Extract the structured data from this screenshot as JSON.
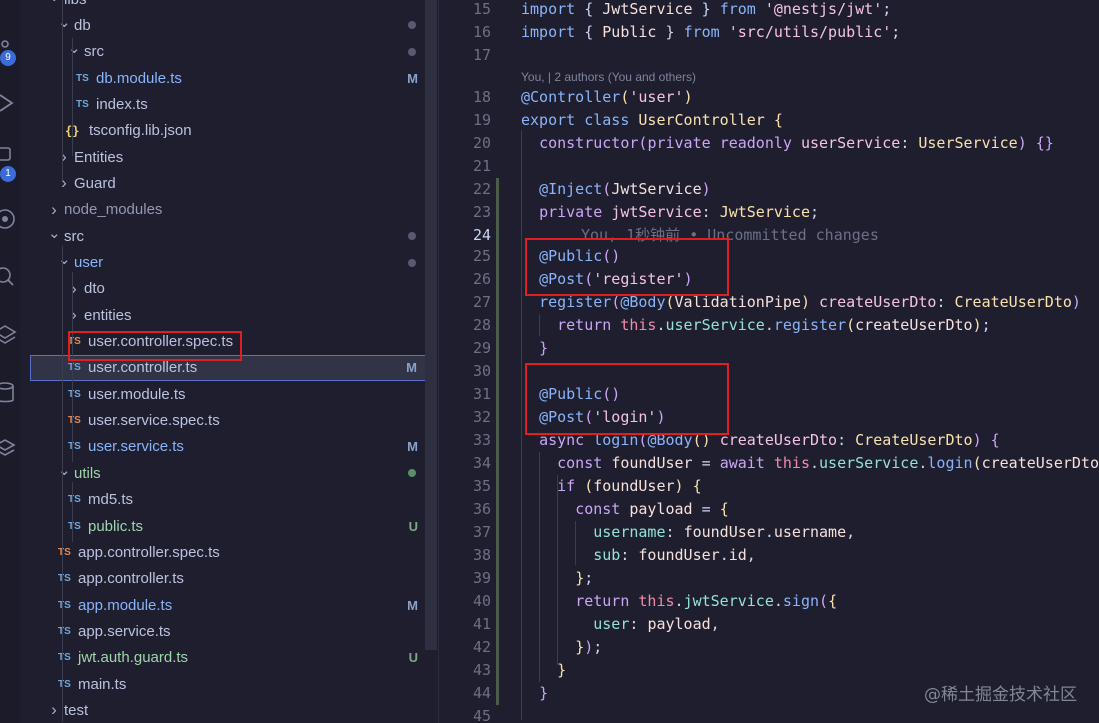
{
  "activity_bar": {
    "badges": {
      "source_control": "9",
      "extensions": "1"
    },
    "icons": [
      "source-control-icon",
      "run-debug-icon",
      "extensions-icon",
      "remote-icon",
      "search-icon",
      "layers-icon",
      "database-icon",
      "stack-icon"
    ]
  },
  "explorer": {
    "rows": [
      {
        "label": "libs",
        "kind": "folder",
        "open": true,
        "color": "folder"
      },
      {
        "label": "db",
        "kind": "folder",
        "open": true,
        "color": "folder",
        "dot": true
      },
      {
        "label": "src",
        "kind": "folder",
        "open": true,
        "color": "folder",
        "dot": true
      },
      {
        "label": "db.module.ts",
        "kind": "ts",
        "color": "modified",
        "status": "M"
      },
      {
        "label": "index.ts",
        "kind": "ts",
        "color": "default"
      },
      {
        "label": "tsconfig.lib.json",
        "kind": "json",
        "color": "default"
      },
      {
        "label": "Entities",
        "kind": "folder",
        "open": false,
        "color": "folder"
      },
      {
        "label": "Guard",
        "kind": "folder",
        "open": false,
        "color": "folder"
      },
      {
        "label": "node_modules",
        "kind": "folder",
        "open": false,
        "color": "dim"
      },
      {
        "label": "src",
        "kind": "folder",
        "open": true,
        "color": "folder",
        "dot": true
      },
      {
        "label": "user",
        "kind": "folder",
        "open": true,
        "color": "modified",
        "dot": true
      },
      {
        "label": "dto",
        "kind": "folder",
        "open": false,
        "color": "folder"
      },
      {
        "label": "entities",
        "kind": "folder",
        "open": false,
        "color": "folder"
      },
      {
        "label": "user.controller.spec.ts",
        "kind": "spec",
        "color": "default"
      },
      {
        "label": "user.controller.ts",
        "kind": "ts",
        "color": "default",
        "status": "M",
        "selected": true
      },
      {
        "label": "user.module.ts",
        "kind": "ts",
        "color": "default"
      },
      {
        "label": "user.service.spec.ts",
        "kind": "spec",
        "color": "default"
      },
      {
        "label": "user.service.ts",
        "kind": "ts",
        "color": "modified",
        "status": "M"
      },
      {
        "label": "utils",
        "kind": "folder",
        "open": true,
        "color": "untracked",
        "dot": "green"
      },
      {
        "label": "md5.ts",
        "kind": "ts",
        "color": "default"
      },
      {
        "label": "public.ts",
        "kind": "ts",
        "color": "untracked",
        "status": "U"
      },
      {
        "label": "app.controller.spec.ts",
        "kind": "spec",
        "color": "default"
      },
      {
        "label": "app.controller.ts",
        "kind": "ts",
        "color": "default"
      },
      {
        "label": "app.module.ts",
        "kind": "ts",
        "color": "modified",
        "status": "M"
      },
      {
        "label": "app.service.ts",
        "kind": "ts",
        "color": "default"
      },
      {
        "label": "jwt.auth.guard.ts",
        "kind": "ts",
        "color": "untracked",
        "status": "U"
      },
      {
        "label": "main.ts",
        "kind": "ts",
        "color": "default"
      },
      {
        "label": "test",
        "kind": "folder",
        "open": false,
        "color": "folder"
      }
    ]
  },
  "editor": {
    "blame_header": "You, | 2 authors (You and others)",
    "inline_blame": "You, 1秒钟前 • Uncommitted changes",
    "lines": [
      {
        "n": "15",
        "tokens": [
          [
            "kw",
            "import"
          ],
          [
            "punc",
            " { "
          ],
          [
            "var",
            "JwtService"
          ],
          [
            "punc",
            " } "
          ],
          [
            "kw",
            "from"
          ],
          [
            "punc",
            " "
          ],
          [
            "str",
            "'@nestjs/jwt'"
          ],
          [
            "punc",
            ";"
          ]
        ]
      },
      {
        "n": "16",
        "tokens": [
          [
            "kw",
            "import"
          ],
          [
            "punc",
            " { "
          ],
          [
            "var",
            "Public"
          ],
          [
            "punc",
            " } "
          ],
          [
            "kw",
            "from"
          ],
          [
            "punc",
            " "
          ],
          [
            "str",
            "'src/utils/public'"
          ],
          [
            "punc",
            ";"
          ]
        ]
      },
      {
        "n": "17",
        "tokens": []
      },
      {
        "n": "18",
        "tokens": [
          [
            "dec",
            "@Controller"
          ],
          [
            "brace",
            "("
          ],
          [
            "str",
            "'user'"
          ],
          [
            "brace",
            ")"
          ]
        ]
      },
      {
        "n": "19",
        "tokens": [
          [
            "kw",
            "export"
          ],
          [
            "punc",
            " "
          ],
          [
            "kw",
            "class"
          ],
          [
            "punc",
            " "
          ],
          [
            "cls",
            "UserController"
          ],
          [
            "punc",
            " "
          ],
          [
            "brace",
            "{"
          ]
        ]
      },
      {
        "n": "20",
        "tokens": [
          [
            "punc",
            "  "
          ],
          [
            "kw2",
            "constructor"
          ],
          [
            "brace2",
            "("
          ],
          [
            "kw2",
            "private"
          ],
          [
            "punc",
            " "
          ],
          [
            "kw2",
            "readonly"
          ],
          [
            "punc",
            " "
          ],
          [
            "param",
            "userService"
          ],
          [
            "punc",
            ": "
          ],
          [
            "cls",
            "UserService"
          ],
          [
            "brace2",
            ")"
          ],
          [
            "punc",
            " "
          ],
          [
            "brace2",
            "{}"
          ]
        ]
      },
      {
        "n": "21",
        "tokens": []
      },
      {
        "n": "22",
        "tokens": [
          [
            "punc",
            "  "
          ],
          [
            "dec",
            "@Inject"
          ],
          [
            "brace2",
            "("
          ],
          [
            "var",
            "JwtService"
          ],
          [
            "brace2",
            ")"
          ]
        ]
      },
      {
        "n": "23",
        "tokens": [
          [
            "punc",
            "  "
          ],
          [
            "kw2",
            "private"
          ],
          [
            "punc",
            " "
          ],
          [
            "param",
            "jwtService"
          ],
          [
            "punc",
            ": "
          ],
          [
            "cls",
            "JwtService"
          ],
          [
            "punc",
            ";"
          ]
        ]
      },
      {
        "n": "24",
        "tokens": [],
        "active": true
      },
      {
        "n": "25",
        "tokens": [
          [
            "punc",
            "  "
          ],
          [
            "dec",
            "@Public"
          ],
          [
            "brace2",
            "()"
          ]
        ]
      },
      {
        "n": "26",
        "tokens": [
          [
            "punc",
            "  "
          ],
          [
            "dec",
            "@Post"
          ],
          [
            "brace2",
            "("
          ],
          [
            "str",
            "'register'"
          ],
          [
            "brace2",
            ")"
          ]
        ]
      },
      {
        "n": "27",
        "tokens": [
          [
            "punc",
            "  "
          ],
          [
            "fn",
            "register"
          ],
          [
            "brace2",
            "("
          ],
          [
            "dec",
            "@Body"
          ],
          [
            "brace",
            "("
          ],
          [
            "var",
            "ValidationPipe"
          ],
          [
            "brace",
            ")"
          ],
          [
            "punc",
            " "
          ],
          [
            "param",
            "createUserDto"
          ],
          [
            "punc",
            ": "
          ],
          [
            "cls",
            "CreateUserDto"
          ],
          [
            "brace2",
            ")"
          ]
        ]
      },
      {
        "n": "28",
        "tokens": [
          [
            "punc",
            "    "
          ],
          [
            "kw2",
            "return"
          ],
          [
            "punc",
            " "
          ],
          [
            "this",
            "this"
          ],
          [
            "punc",
            "."
          ],
          [
            "prop",
            "userService"
          ],
          [
            "punc",
            "."
          ],
          [
            "fn",
            "register"
          ],
          [
            "brace",
            "("
          ],
          [
            "var",
            "createUserDto"
          ],
          [
            "brace",
            ")"
          ],
          [
            "punc",
            ";"
          ]
        ]
      },
      {
        "n": "29",
        "tokens": [
          [
            "punc",
            "  "
          ],
          [
            "brace2",
            "}"
          ]
        ]
      },
      {
        "n": "30",
        "tokens": []
      },
      {
        "n": "31",
        "tokens": [
          [
            "punc",
            "  "
          ],
          [
            "dec",
            "@Public"
          ],
          [
            "brace2",
            "()"
          ]
        ]
      },
      {
        "n": "32",
        "tokens": [
          [
            "punc",
            "  "
          ],
          [
            "dec",
            "@Post"
          ],
          [
            "brace2",
            "("
          ],
          [
            "str",
            "'login'"
          ],
          [
            "brace2",
            ")"
          ]
        ]
      },
      {
        "n": "33",
        "tokens": [
          [
            "punc",
            "  "
          ],
          [
            "kw2",
            "async"
          ],
          [
            "punc",
            " "
          ],
          [
            "fn",
            "login"
          ],
          [
            "brace2",
            "("
          ],
          [
            "dec",
            "@Body"
          ],
          [
            "brace",
            "()"
          ],
          [
            "punc",
            " "
          ],
          [
            "param",
            "createUserDto"
          ],
          [
            "punc",
            ": "
          ],
          [
            "cls",
            "CreateUserDto"
          ],
          [
            "brace2",
            ")"
          ],
          [
            "punc",
            " "
          ],
          [
            "brace2",
            "{"
          ]
        ]
      },
      {
        "n": "34",
        "tokens": [
          [
            "punc",
            "    "
          ],
          [
            "kw2",
            "const"
          ],
          [
            "punc",
            " "
          ],
          [
            "var",
            "foundUser"
          ],
          [
            "punc",
            " = "
          ],
          [
            "kw2",
            "await"
          ],
          [
            "punc",
            " "
          ],
          [
            "this",
            "this"
          ],
          [
            "punc",
            "."
          ],
          [
            "prop",
            "userService"
          ],
          [
            "punc",
            "."
          ],
          [
            "fn",
            "login"
          ],
          [
            "brace",
            "("
          ],
          [
            "var",
            "createUserDto"
          ]
        ]
      },
      {
        "n": "35",
        "tokens": [
          [
            "punc",
            "    "
          ],
          [
            "kw2",
            "if"
          ],
          [
            "punc",
            " "
          ],
          [
            "brace",
            "("
          ],
          [
            "var",
            "foundUser"
          ],
          [
            "brace",
            ")"
          ],
          [
            "punc",
            " "
          ],
          [
            "brace",
            "{"
          ]
        ]
      },
      {
        "n": "36",
        "tokens": [
          [
            "punc",
            "      "
          ],
          [
            "kw2",
            "const"
          ],
          [
            "punc",
            " "
          ],
          [
            "var",
            "payload"
          ],
          [
            "punc",
            " = "
          ],
          [
            "brace",
            "{"
          ]
        ]
      },
      {
        "n": "37",
        "tokens": [
          [
            "punc",
            "        "
          ],
          [
            "prop",
            "username"
          ],
          [
            "punc",
            ": "
          ],
          [
            "var",
            "foundUser"
          ],
          [
            "punc",
            "."
          ],
          [
            "var",
            "username"
          ],
          [
            "punc",
            ","
          ]
        ]
      },
      {
        "n": "38",
        "tokens": [
          [
            "punc",
            "        "
          ],
          [
            "prop",
            "sub"
          ],
          [
            "punc",
            ": "
          ],
          [
            "var",
            "foundUser"
          ],
          [
            "punc",
            "."
          ],
          [
            "var",
            "id"
          ],
          [
            "punc",
            ","
          ]
        ]
      },
      {
        "n": "39",
        "tokens": [
          [
            "punc",
            "      "
          ],
          [
            "brace",
            "}"
          ],
          [
            "punc",
            ";"
          ]
        ]
      },
      {
        "n": "40",
        "tokens": [
          [
            "punc",
            "      "
          ],
          [
            "kw2",
            "return"
          ],
          [
            "punc",
            " "
          ],
          [
            "this",
            "this"
          ],
          [
            "punc",
            "."
          ],
          [
            "prop",
            "jwtService"
          ],
          [
            "punc",
            "."
          ],
          [
            "fn",
            "sign"
          ],
          [
            "brace2",
            "("
          ],
          [
            "brace",
            "{"
          ]
        ]
      },
      {
        "n": "41",
        "tokens": [
          [
            "punc",
            "        "
          ],
          [
            "prop",
            "user"
          ],
          [
            "punc",
            ": "
          ],
          [
            "var",
            "payload"
          ],
          [
            "punc",
            ","
          ]
        ]
      },
      {
        "n": "42",
        "tokens": [
          [
            "punc",
            "      "
          ],
          [
            "brace",
            "}"
          ],
          [
            "brace2",
            ")"
          ],
          [
            "punc",
            ";"
          ]
        ]
      },
      {
        "n": "43",
        "tokens": [
          [
            "punc",
            "    "
          ],
          [
            "brace",
            "}"
          ]
        ]
      },
      {
        "n": "44",
        "tokens": [
          [
            "punc",
            "  "
          ],
          [
            "brace2",
            "}"
          ]
        ]
      },
      {
        "n": "45",
        "tokens": []
      }
    ]
  },
  "watermark": "@稀土掘金技术社区"
}
